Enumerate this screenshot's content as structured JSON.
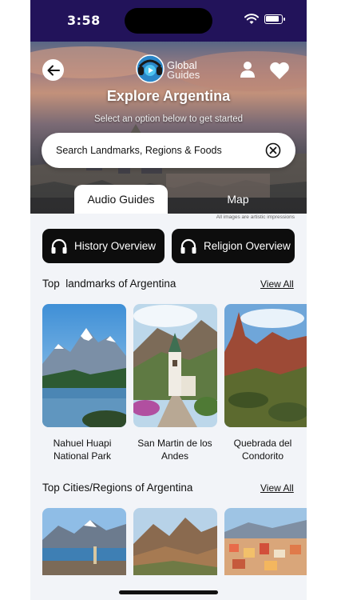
{
  "status_bar": {
    "time": "3:58"
  },
  "header": {
    "logo_line1": "Global",
    "logo_line2": "Guides",
    "title": "Explore Argentina",
    "subtitle": "Select an option below to get started"
  },
  "search": {
    "placeholder": "Search Landmarks, Regions & Foods"
  },
  "tabs": [
    {
      "label": "Audio Guides",
      "selected": true
    },
    {
      "label": "Map",
      "selected": false
    }
  ],
  "disclaimer": "All images are artistic impressions",
  "overview_buttons": [
    {
      "label": "History Overview",
      "icon": "headphones-icon"
    },
    {
      "label": "Religion Overview",
      "icon": "headphones-icon"
    }
  ],
  "landmarks_section": {
    "title": "Top  landmarks of Argentina",
    "view_all": "View All",
    "items": [
      {
        "name_line1": "Nahuel Huapi",
        "name_line2": "National Park"
      },
      {
        "name_line1": "San Martin de los",
        "name_line2": "Andes"
      },
      {
        "name_line1": "Quebrada del",
        "name_line2": "Condorito"
      }
    ]
  },
  "cities_section": {
    "title": "Top Cities/Regions of Argentina",
    "view_all": "View All"
  },
  "colors": {
    "status_bar": "#22135a",
    "button_dark": "#0d0d0d",
    "background": "#f2f4f8"
  }
}
